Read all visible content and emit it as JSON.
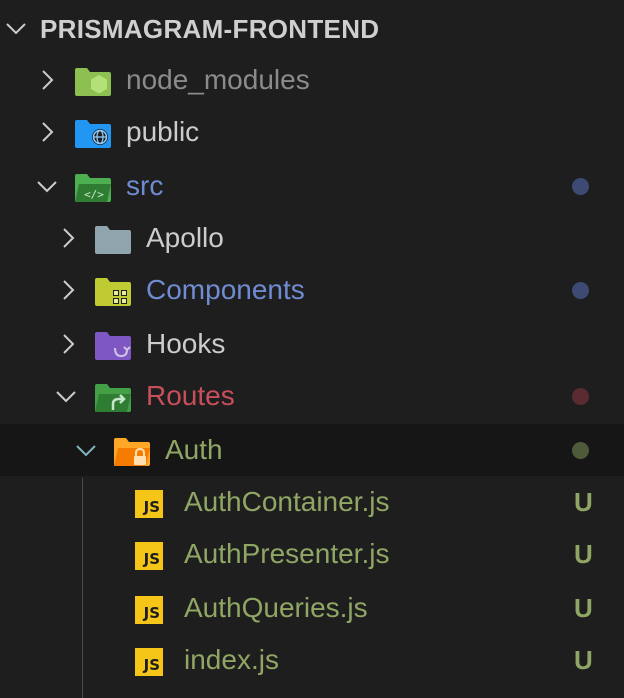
{
  "explorer": {
    "root": {
      "label": "PRISMAGRAM-FRONTEND",
      "expanded": true
    },
    "tree": [
      {
        "label": "node_modules",
        "icon": "node-modules-folder-icon",
        "expanded": false,
        "color": "#8b8b8b",
        "status": null
      },
      {
        "label": "public",
        "icon": "public-folder-icon",
        "expanded": false,
        "color": "#cccccc",
        "status": null
      },
      {
        "label": "src",
        "icon": "src-folder-icon",
        "expanded": true,
        "color": "#6f8bd1",
        "status": "modified"
      },
      {
        "label": "Apollo",
        "icon": "folder-icon",
        "expanded": false,
        "color": "#cccccc",
        "status": null
      },
      {
        "label": "Components",
        "icon": "components-folder-icon",
        "expanded": false,
        "color": "#6f8bd1",
        "status": "modified"
      },
      {
        "label": "Hooks",
        "icon": "hooks-folder-icon",
        "expanded": false,
        "color": "#cccccc",
        "status": null
      },
      {
        "label": "Routes",
        "icon": "routes-folder-icon",
        "expanded": true,
        "color": "#c74e5b",
        "status": "conflict"
      },
      {
        "label": "Auth",
        "icon": "auth-folder-icon",
        "expanded": true,
        "color": "#8fa664",
        "status": "untracked",
        "selected": true
      },
      {
        "label": "AuthContainer.js",
        "icon": "js-file-icon",
        "color": "#8fa664",
        "badge": "U"
      },
      {
        "label": "AuthPresenter.js",
        "icon": "js-file-icon",
        "color": "#8fa664",
        "badge": "U"
      },
      {
        "label": "AuthQueries.js",
        "icon": "js-file-icon",
        "color": "#8fa664",
        "badge": "U"
      },
      {
        "label": "index.js",
        "icon": "js-file-icon",
        "color": "#8fa664",
        "badge": "U"
      }
    ],
    "js_icon_text": "JS"
  },
  "colors": {
    "background": "#1e1e1e",
    "selected_row": "#161616",
    "modified_dot": "#3d4a73",
    "conflict_dot": "#5a2b30",
    "untracked_dot": "#4f5a3a",
    "untracked_text": "#8fa664",
    "js_icon": "#f5c518"
  }
}
